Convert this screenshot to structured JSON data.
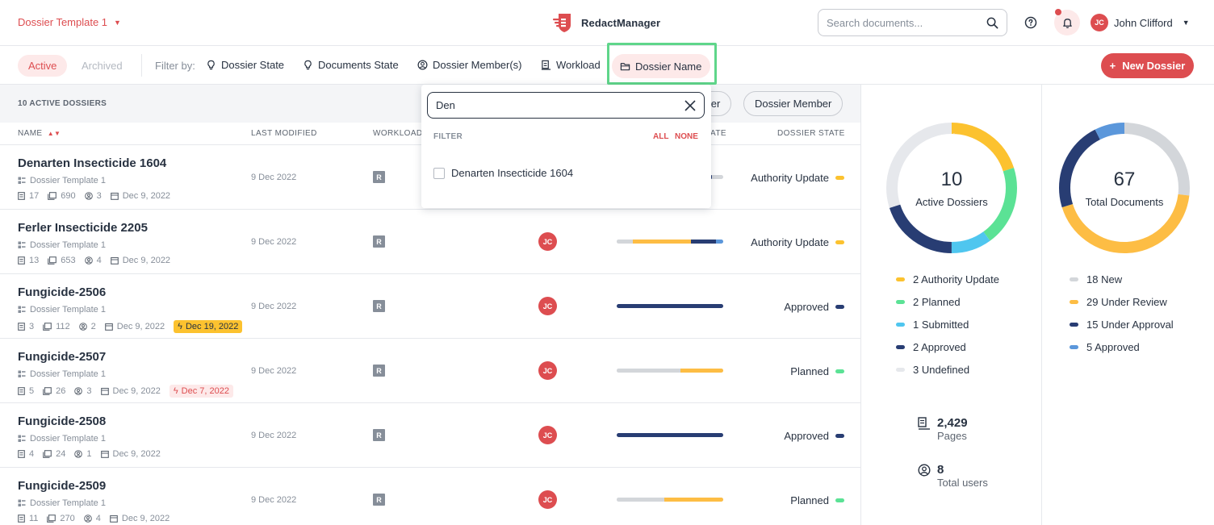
{
  "header": {
    "template_switch": "Dossier Template 1",
    "brand": "RedactManager",
    "search_placeholder": "Search documents...",
    "user_initials": "JC",
    "user_name": "John Clifford",
    "accent_color": "#dd4d50"
  },
  "filterbar": {
    "active_label": "Active",
    "archived_label": "Archived",
    "filter_by": "Filter by:",
    "filters": [
      "Dossier State",
      "Documents State",
      "Dossier Member(s)",
      "Workload",
      "Dossier Name"
    ],
    "new_dossier": "New Dossier"
  },
  "list": {
    "count_label": "10 ACTIVE DOSSIERS",
    "chips": [
      "Owner",
      "Dossier Member"
    ],
    "columns": {
      "name": "NAME",
      "last_modified": "LAST MODIFIED",
      "workload": "WORKLOAD",
      "state_partial": "ATE",
      "dossier_state": "DOSSIER STATE"
    },
    "rows": [
      {
        "title": "Denarten Insecticide 1604",
        "template": "Dossier Template 1",
        "docs": "17",
        "pages": "690",
        "members": "3",
        "created": "Dec 9, 2022",
        "due": "",
        "due_kind": "",
        "modified": "9 Dec 2022",
        "workload": "R",
        "avatar": "",
        "state": "Authority Update",
        "state_color": "#fcc22f",
        "progress": [
          {
            "c": "#283d73",
            "w": 0.15
          }
        ]
      },
      {
        "title": "Ferler Insecticide 2205",
        "template": "Dossier Template 1",
        "docs": "13",
        "pages": "653",
        "members": "4",
        "created": "Dec 9, 2022",
        "due": "",
        "due_kind": "",
        "modified": "9 Dec 2022",
        "workload": "R",
        "avatar": "JC",
        "state": "Authority Update",
        "state_color": "#fcc22f",
        "progress": [
          {
            "c": "#d3d6da",
            "w": 0.15
          },
          {
            "c": "#fdbd44",
            "w": 0.55
          },
          {
            "c": "#283d73",
            "w": 0.23
          },
          {
            "c": "#5b97db",
            "w": 0.07
          }
        ]
      },
      {
        "title": "Fungicide-2506",
        "template": "Dossier Template 1",
        "docs": "3",
        "pages": "112",
        "members": "2",
        "created": "Dec 9, 2022",
        "due": "Dec 19, 2022",
        "due_kind": "warn",
        "modified": "9 Dec 2022",
        "workload": "R",
        "avatar": "JC",
        "state": "Approved",
        "state_color": "#283d73",
        "progress": [
          {
            "c": "#283d73",
            "w": 1
          }
        ]
      },
      {
        "title": "Fungicide-2507",
        "template": "Dossier Template 1",
        "docs": "5",
        "pages": "26",
        "members": "3",
        "created": "Dec 9, 2022",
        "due": "Dec 7, 2022",
        "due_kind": "over",
        "modified": "9 Dec 2022",
        "workload": "R",
        "avatar": "JC",
        "state": "Planned",
        "state_color": "#5be295",
        "progress": [
          {
            "c": "#d3d6da",
            "w": 0.6
          },
          {
            "c": "#fdbd44",
            "w": 0.4
          }
        ]
      },
      {
        "title": "Fungicide-2508",
        "template": "Dossier Template 1",
        "docs": "4",
        "pages": "24",
        "members": "1",
        "created": "Dec 9, 2022",
        "due": "",
        "due_kind": "",
        "modified": "9 Dec 2022",
        "workload": "R",
        "avatar": "JC",
        "state": "Approved",
        "state_color": "#283d73",
        "progress": [
          {
            "c": "#283d73",
            "w": 1
          }
        ]
      },
      {
        "title": "Fungicide-2509",
        "template": "Dossier Template 1",
        "docs": "11",
        "pages": "270",
        "members": "4",
        "created": "Dec 9, 2022",
        "due": "",
        "due_kind": "",
        "modified": "9 Dec 2022",
        "workload": "R",
        "avatar": "JC",
        "state": "Planned",
        "state_color": "#5be295",
        "progress": [
          {
            "c": "#d3d6da",
            "w": 0.45
          },
          {
            "c": "#fdbd44",
            "w": 0.55
          }
        ]
      }
    ]
  },
  "dropdown": {
    "query": "Den",
    "filter_label": "FILTER",
    "all": "ALL",
    "none": "NONE",
    "options": [
      "Denarten Insecticide 1604"
    ]
  },
  "stats": {
    "dossiers": {
      "total": "10",
      "label": "Active Dossiers",
      "segments": [
        {
          "label": "2 Authority Update",
          "value": 2,
          "color": "#fcc22f"
        },
        {
          "label": "2 Planned",
          "value": 2,
          "color": "#5be295"
        },
        {
          "label": "1 Submitted",
          "value": 1,
          "color": "#4fc6ef"
        },
        {
          "label": "2 Approved",
          "value": 2,
          "color": "#283d73"
        },
        {
          "label": "3 Undefined",
          "value": 3,
          "color": "#e6e8ec"
        }
      ]
    },
    "documents": {
      "total": "67",
      "label": "Total Documents",
      "segments": [
        {
          "label": "18 New",
          "value": 18,
          "color": "#d3d6da"
        },
        {
          "label": "29 Under Review",
          "value": 29,
          "color": "#fdbd44"
        },
        {
          "label": "15 Under Approval",
          "value": 15,
          "color": "#283d73"
        },
        {
          "label": "5 Approved",
          "value": 5,
          "color": "#5b97db"
        }
      ]
    },
    "pages_value": "2,429",
    "pages_label": "Pages",
    "users_value": "8",
    "users_label": "Total users"
  }
}
